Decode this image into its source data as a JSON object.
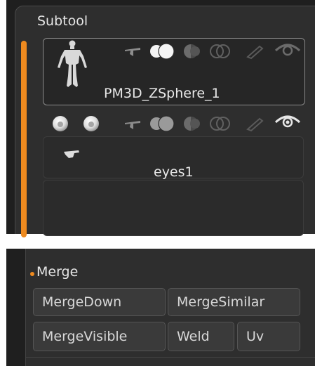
{
  "subtool": {
    "title": "Subtool",
    "items": [
      {
        "name": "PM3D_ZSphere_1",
        "selected": true,
        "visible": false
      },
      {
        "name": "eyes1",
        "selected": false,
        "visible": true
      }
    ]
  },
  "merge": {
    "title": "Merge",
    "buttons": {
      "merge_down": "MergeDown",
      "merge_similar": "MergeSimilar",
      "merge_visible": "MergeVisible",
      "weld": "Weld",
      "uv": "Uv"
    }
  },
  "colors": {
    "accent": "#ee8a1f",
    "panel_bg": "#2e2e2e",
    "button_bg": "#3a3a3a"
  },
  "icons": {
    "item_thumb_1": "human-figure-icon",
    "item_thumb_2": "eyes-mesh-icon",
    "sphere_left": "sphere-icon",
    "sphere_right": "sphere-icon",
    "controls": [
      "arrow-down-icon",
      "toggle-pair-icon",
      "half-circle-icon",
      "overlap-circle-icon",
      "brush-icon",
      "eye-icon"
    ]
  }
}
